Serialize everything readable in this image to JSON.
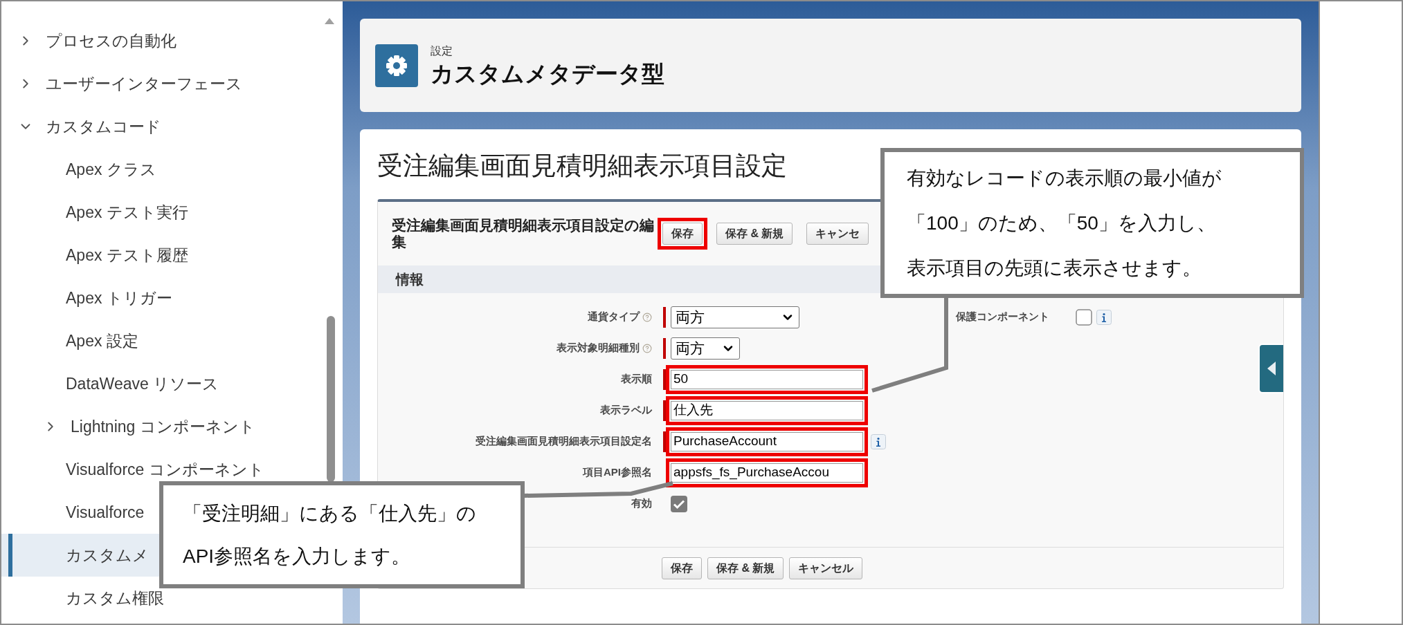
{
  "sidebar": {
    "items": [
      {
        "label": "プロセスの自動化",
        "expanded": false,
        "selected": false
      },
      {
        "label": "ユーザーインターフェース",
        "expanded": false,
        "selected": false
      },
      {
        "label": "カスタムコード",
        "expanded": true,
        "selected": false,
        "children": [
          {
            "label": "Apex クラス",
            "selected": false
          },
          {
            "label": "Apex テスト実行",
            "selected": false
          },
          {
            "label": "Apex テスト履歴",
            "selected": false
          },
          {
            "label": "Apex トリガー",
            "selected": false
          },
          {
            "label": "Apex 設定",
            "selected": false
          },
          {
            "label": "DataWeave リソース",
            "selected": false
          },
          {
            "label": "Lightning コンポーネント",
            "expanded": false,
            "selected": false
          },
          {
            "label": "Visualforce コンポーネント",
            "selected": false
          },
          {
            "label": "Visualforce",
            "selected": false
          },
          {
            "label": "カスタムメ",
            "selected": true
          },
          {
            "label": "カスタム権限",
            "selected": false
          }
        ]
      }
    ]
  },
  "header": {
    "breadcrumb": "設定",
    "title": "カスタムメタデータ型"
  },
  "page_title": "受注編集画面見積明細表示項目設定",
  "edit": {
    "title": "受注編集画面見積明細表示項目設定の編集",
    "top_buttons": [
      {
        "label": "保存",
        "highlighted": true
      },
      {
        "label": "保存 & 新規",
        "highlighted": false
      },
      {
        "label": "キャンセ",
        "highlighted": false
      }
    ],
    "section": "情報",
    "fields": [
      {
        "kind": "select",
        "label": "通貨タイプ",
        "help": true,
        "required": true,
        "value": "両方",
        "wide": true,
        "highlighted": false
      },
      {
        "kind": "select",
        "label": "表示対象明細種別",
        "help": true,
        "required": true,
        "value": "両方",
        "wide": false,
        "highlighted": false
      },
      {
        "kind": "text",
        "label": "表示順",
        "required": true,
        "value": "50",
        "highlighted": true
      },
      {
        "kind": "text",
        "label": "表示ラベル",
        "required": true,
        "value": "仕入先",
        "highlighted": true
      },
      {
        "kind": "text",
        "label": "受注編集画面見積明細表示項目設定名",
        "required": true,
        "value": "PurchaseAccount",
        "highlighted": true,
        "info": true
      },
      {
        "kind": "text",
        "label": "項目API参照名",
        "required": false,
        "value": "appsfs_fs_PurchaseAccou",
        "highlighted": true
      },
      {
        "kind": "checkbox",
        "label": "有効",
        "checked": true
      }
    ],
    "side_fields": [
      {
        "kind": "checkbox",
        "label": "保護コンポーネント",
        "checked": false,
        "info": true
      }
    ],
    "bottom_buttons": [
      {
        "label": "保存"
      },
      {
        "label": "保存 & 新規"
      },
      {
        "label": "キャンセル"
      }
    ]
  },
  "callouts": [
    {
      "lines": [
        "有効なレコードの表示順の最小値が",
        "「100」のため、「50」を入力し、",
        "表示項目の先頭に表示させます。"
      ]
    },
    {
      "lines": [
        "「受注明細」にある「仕入先」の",
        "API参照名を入力します。"
      ]
    }
  ]
}
